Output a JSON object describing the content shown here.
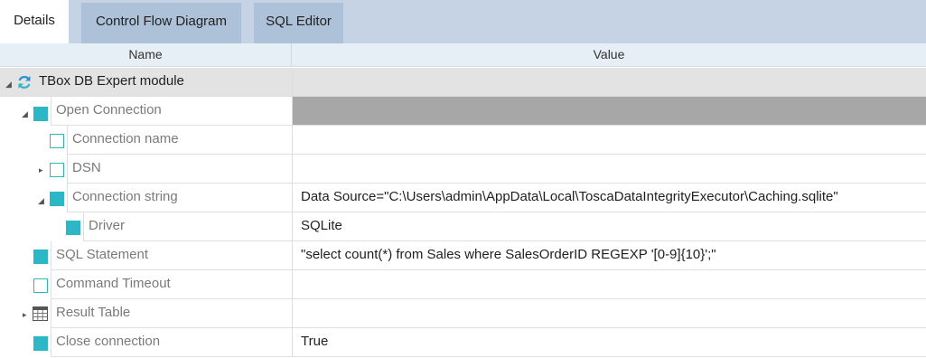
{
  "tabs": [
    {
      "label": "Details",
      "active": true
    },
    {
      "label": "Control Flow Diagram",
      "active": false
    },
    {
      "label": "SQL Editor",
      "active": false
    }
  ],
  "columns": {
    "name": "Name",
    "value": "Value"
  },
  "tree": {
    "root": {
      "label": "TBox DB Expert module",
      "icon": "refresh-icon",
      "value": ""
    },
    "open_connection": {
      "label": "Open Connection",
      "value": ""
    },
    "connection_name": {
      "label": "Connection name",
      "value": ""
    },
    "dsn": {
      "label": "DSN",
      "value": ""
    },
    "connection_string": {
      "label": "Connection string",
      "value": "Data Source=\"C:\\Users\\admin\\AppData\\Local\\ToscaDataIntegrityExecutor\\Caching.sqlite\""
    },
    "driver": {
      "label": "Driver",
      "value": "SQLite"
    },
    "sql_statement": {
      "label": "SQL Statement",
      "value": "\"select count(*) from Sales where SalesOrderID REGEXP '[0-9]{10}';\""
    },
    "command_timeout": {
      "label": "Command Timeout",
      "value": ""
    },
    "result_table": {
      "label": "Result Table",
      "icon": "table-icon",
      "value": ""
    },
    "close_connection": {
      "label": "Close connection",
      "value": "True"
    }
  },
  "colors": {
    "accent": "#2bb7c6",
    "tabbar": "#c5d3e5",
    "tab_inactive": "#adc1d9",
    "header": "#e6eef6"
  }
}
